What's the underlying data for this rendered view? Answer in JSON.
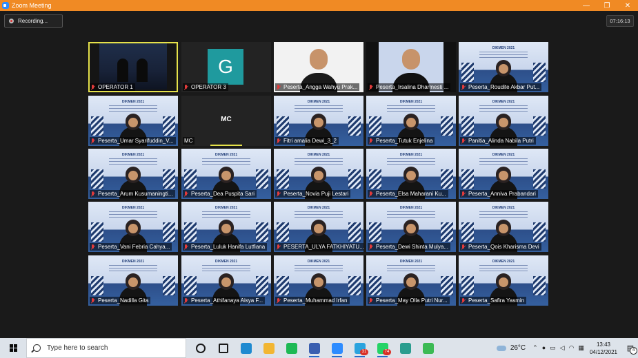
{
  "window": {
    "title": "Zoom Meeting",
    "minimize": "—",
    "maximize": "❐",
    "close": "✕"
  },
  "meeting": {
    "recording_label": "Recording...",
    "timer": "07:16:13"
  },
  "slide_caption": "DIKMEN 2021",
  "tiles": [
    {
      "name": "OPERATOR 1",
      "muted": true,
      "kind": "stage",
      "active": true
    },
    {
      "name": "OPERATOR 3",
      "muted": true,
      "kind": "avatar",
      "avatar_letter": "G"
    },
    {
      "name": "Peserta_Angga Wahyu Prak...",
      "muted": true,
      "kind": "photo"
    },
    {
      "name": "Peserta_Irsalina Dharmesti ...",
      "muted": true,
      "kind": "photo"
    },
    {
      "name": "Peserta_Roudite Akbar Put...",
      "muted": true,
      "kind": "slide"
    },
    {
      "name": "Peserta_Umar Syarifuddin_V...",
      "muted": true,
      "kind": "slide"
    },
    {
      "name": "MC",
      "muted": false,
      "kind": "mc",
      "center_text": "MC"
    },
    {
      "name": "Fitri amalia Dewi_3_2",
      "muted": true,
      "kind": "slide"
    },
    {
      "name": "Peserta_Tutuk Enjelina",
      "muted": true,
      "kind": "slide"
    },
    {
      "name": "Panitia_Alinda Nabila Putri",
      "muted": true,
      "kind": "slide"
    },
    {
      "name": "Peserta_Arum Kusumaningti...",
      "muted": true,
      "kind": "slide"
    },
    {
      "name": "Peserta_Dea Puspita Sari",
      "muted": true,
      "kind": "slide"
    },
    {
      "name": "Peserta_Novia Puji Lestari",
      "muted": true,
      "kind": "slide"
    },
    {
      "name": "Peserta_Elsa Maharani Ku...",
      "muted": true,
      "kind": "slide"
    },
    {
      "name": "Peserta_Anniva Prabandari",
      "muted": true,
      "kind": "slide"
    },
    {
      "name": "Peserta_Vani Febria Cahya...",
      "muted": true,
      "kind": "slide"
    },
    {
      "name": "Peserta_Luluk Hanifa Lutfiana",
      "muted": true,
      "kind": "slide"
    },
    {
      "name": "PESERTA_ULYA FATKHIYATU...",
      "muted": true,
      "kind": "slide"
    },
    {
      "name": "Peserta_Dewi Shinta Mulya...",
      "muted": true,
      "kind": "slide"
    },
    {
      "name": "Peserta_Qois Kharisma Devi",
      "muted": true,
      "kind": "slide"
    },
    {
      "name": "Peserta_Nadilla Gita",
      "muted": true,
      "kind": "slide"
    },
    {
      "name": "Peserta_Athifanaya Aisya F...",
      "muted": true,
      "kind": "slide"
    },
    {
      "name": "Peserta_Muhammad Irfan",
      "muted": true,
      "kind": "slide"
    },
    {
      "name": "Peserta_May Olla Putri Nur...",
      "muted": true,
      "kind": "slide"
    },
    {
      "name": "Peserta_Safira Yasmin",
      "muted": true,
      "kind": "slide"
    }
  ],
  "taskbar": {
    "search_placeholder": "Type here to search",
    "apps": [
      {
        "icon": "cortana-icon",
        "color": "#1b1b1b",
        "open": false
      },
      {
        "icon": "task-view-icon",
        "color": "#1b1b1b",
        "open": false
      },
      {
        "icon": "edge-icon",
        "color": "#1f8ad0",
        "open": false
      },
      {
        "icon": "file-explorer-icon",
        "color": "#f2b632",
        "open": false
      },
      {
        "icon": "spotify-icon",
        "color": "#1db954",
        "open": false
      },
      {
        "icon": "presentation-icon",
        "color": "#3a5fb0",
        "open": true
      },
      {
        "icon": "zoom-icon",
        "color": "#2d8cff",
        "open": true
      },
      {
        "icon": "telegram-icon",
        "color": "#2aa3de",
        "open": true,
        "badge": "31"
      },
      {
        "icon": "whatsapp-icon",
        "color": "#25d366",
        "open": true,
        "badge": "74"
      },
      {
        "icon": "image-app-icon",
        "color": "#2a9d8f",
        "open": false
      },
      {
        "icon": "sheets-icon",
        "color": "#3cba54",
        "open": false
      }
    ],
    "weather": "26°C",
    "time": "13:43",
    "date": "04/12/2021",
    "notification_count": "4"
  }
}
